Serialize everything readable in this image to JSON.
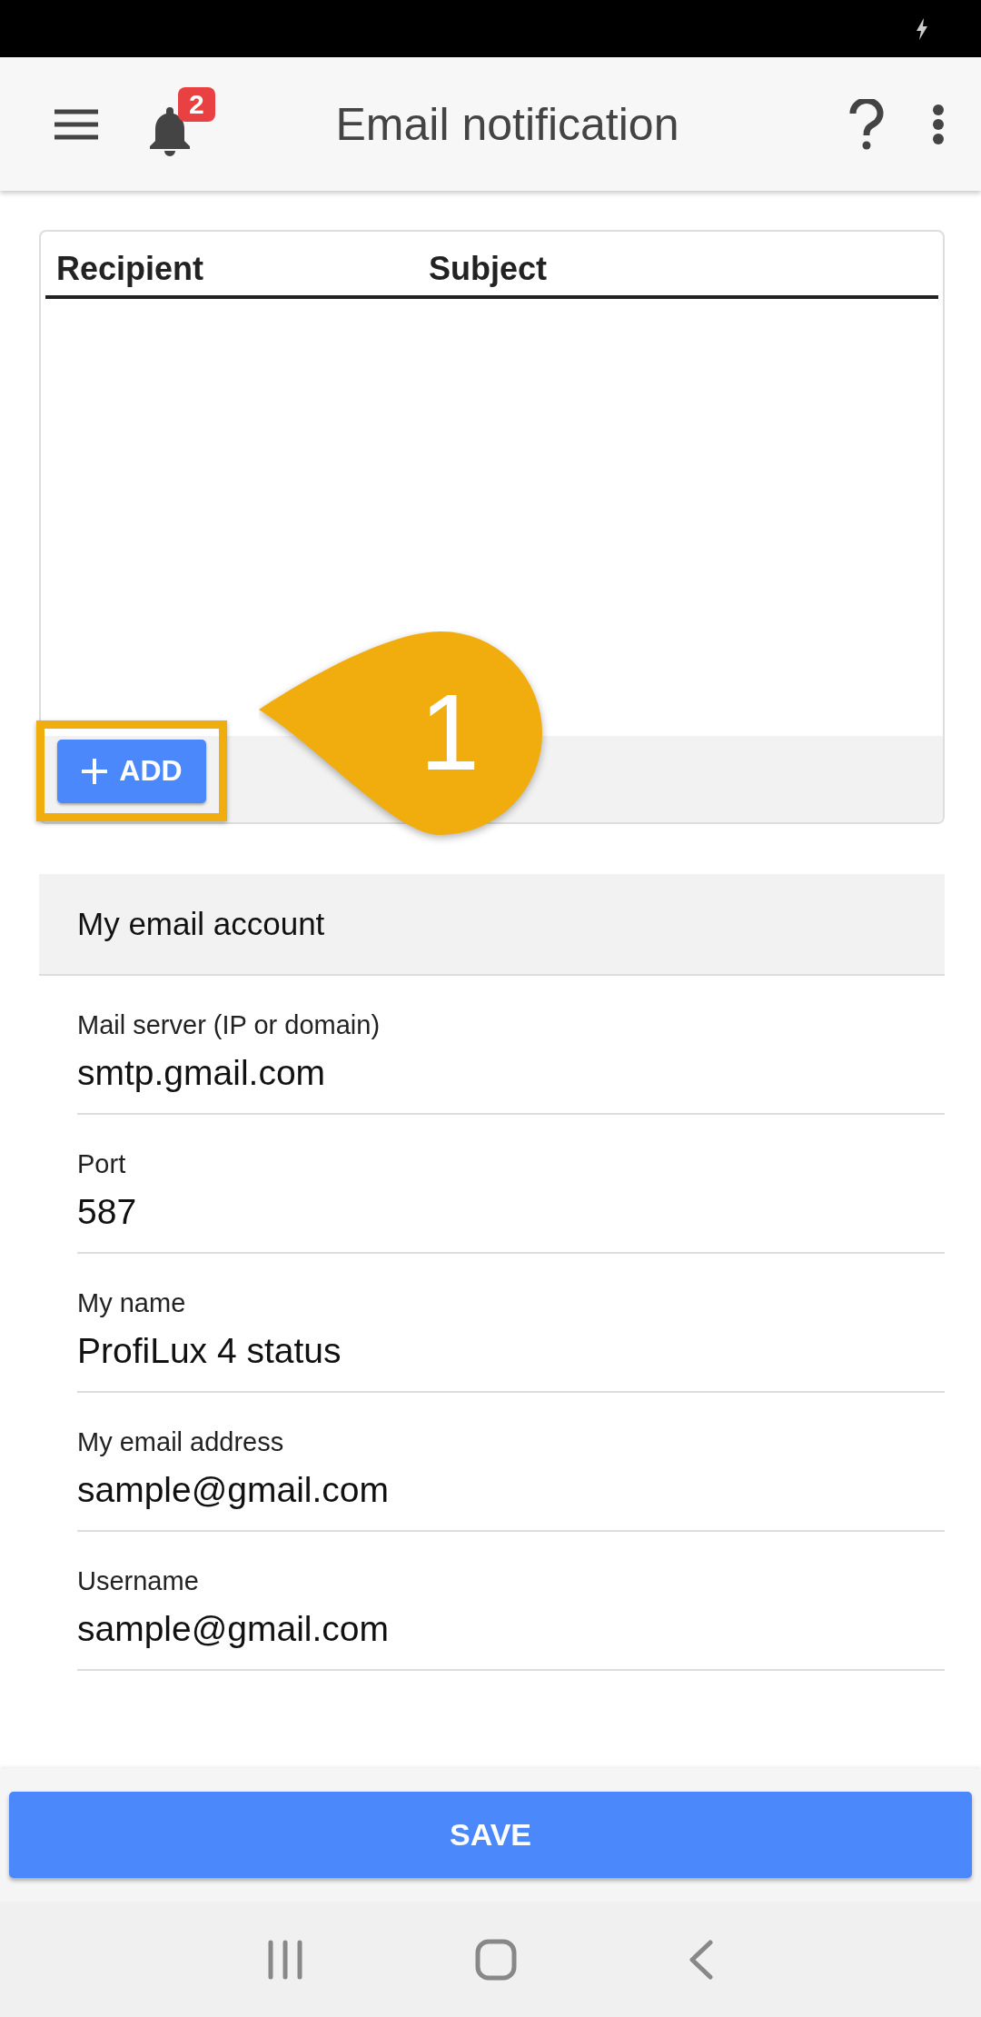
{
  "app_bar": {
    "title": "Email notification",
    "badge": "2"
  },
  "table": {
    "columns": [
      "Recipient",
      "Subject"
    ],
    "add_button": "ADD"
  },
  "callout": {
    "number": "1"
  },
  "section": {
    "title": "My email account"
  },
  "fields": [
    {
      "label": "Mail server (IP or domain)",
      "value": "smtp.gmail.com"
    },
    {
      "label": "Port",
      "value": "587"
    },
    {
      "label": "My name",
      "value": "ProfiLux 4 status"
    },
    {
      "label": "My email address",
      "value": "sample@gmail.com"
    },
    {
      "label": "Username",
      "value": "sample@gmail.com"
    }
  ],
  "save_button": "SAVE"
}
